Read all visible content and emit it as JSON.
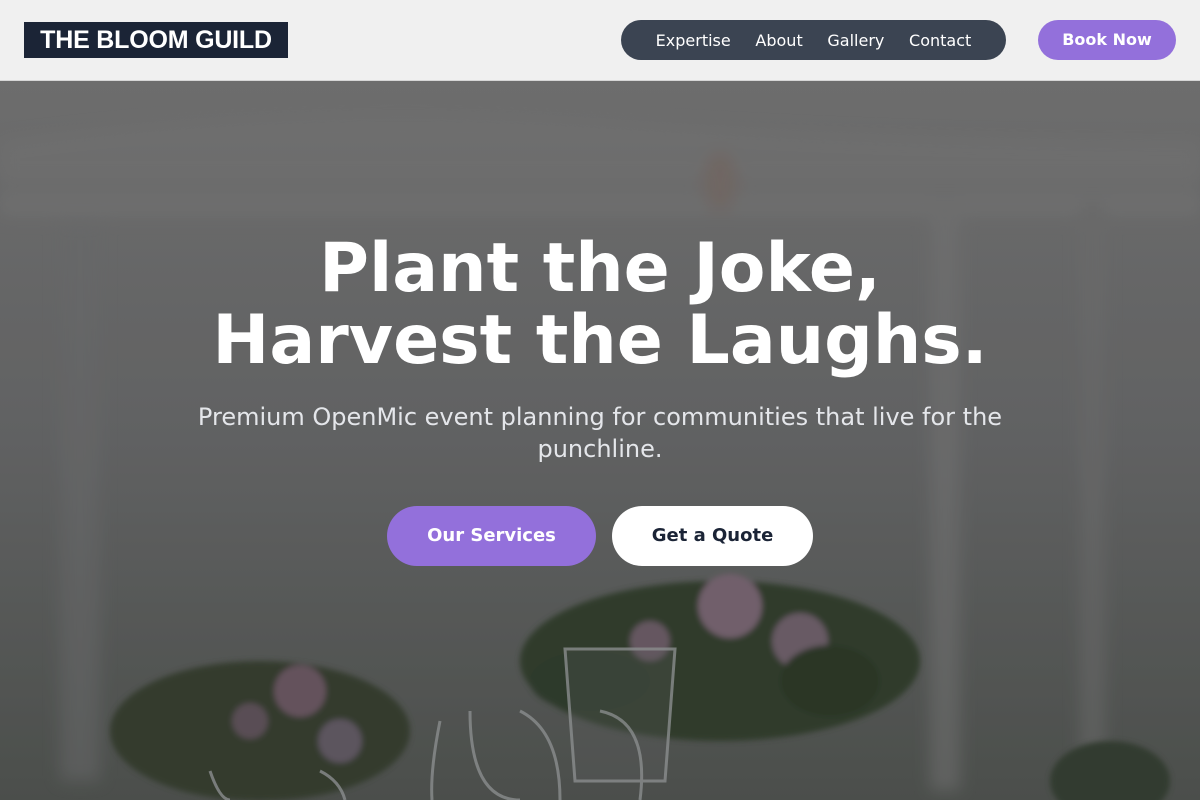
{
  "header": {
    "logo_text": "THE BLOOM GUILD",
    "nav": [
      {
        "label": "Expertise"
      },
      {
        "label": "About"
      },
      {
        "label": "Gallery"
      },
      {
        "label": "Contact"
      }
    ],
    "cta_label": "Book Now"
  },
  "hero": {
    "headline_line1": "Plant the Joke,",
    "headline_line2": "Harvest the Laughs.",
    "subline": "Premium OpenMic event planning for communities that live for the punchline.",
    "primary_button": "Our Services",
    "secondary_button": "Get a Quote",
    "background_image": "blurred-table-with-flowers-and-glassware-photo"
  },
  "colors": {
    "accent": "#9370db",
    "logo_bg": "#1b2436",
    "nav_pill_bg": "#3b4452",
    "header_bg": "#f0f0f0"
  }
}
